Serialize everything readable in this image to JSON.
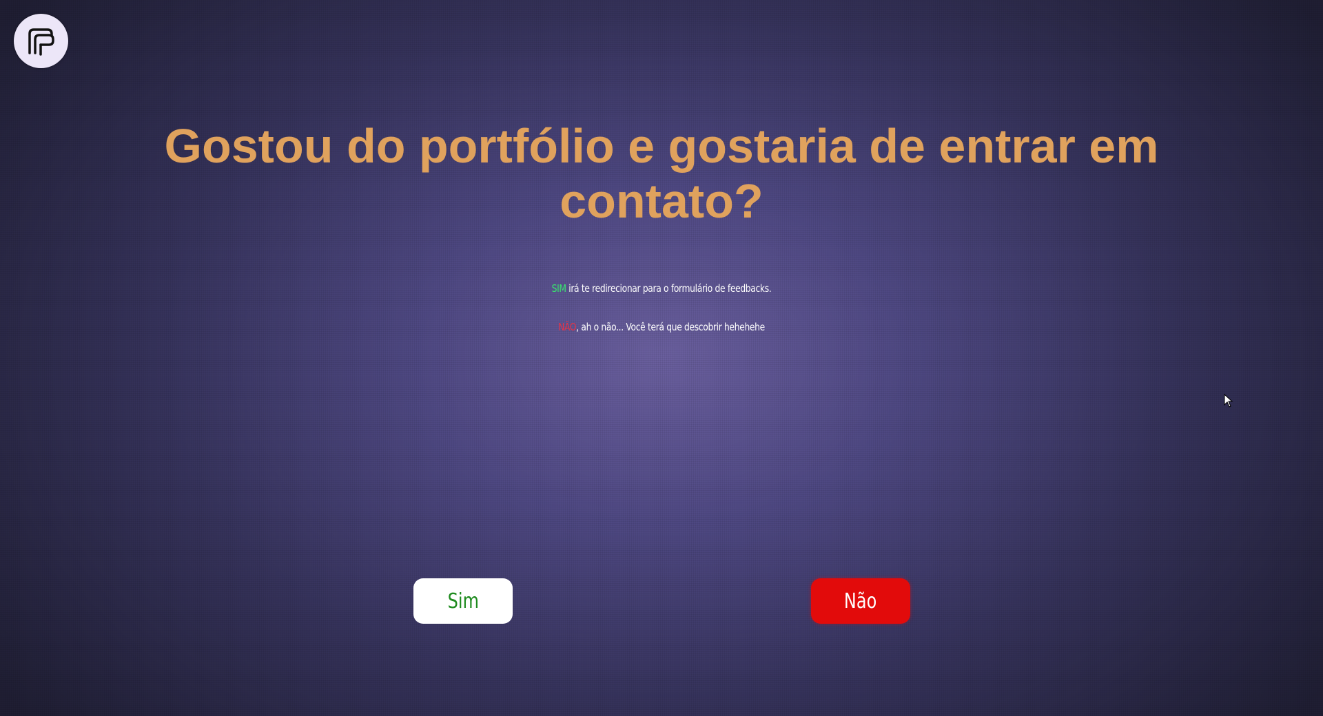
{
  "logo": {
    "icon": "brand-logo-icon",
    "background": "#ece6f8"
  },
  "heading": {
    "text": "Gostou do portfólio e gostaria de entrar em contato?"
  },
  "info": {
    "yes_keyword": "SIM",
    "yes_text": " irá te redirecionar para o formulário de feedbacks.",
    "no_keyword": "NÃO",
    "no_text": ", ah o não... Você terá que descobrir hehehehe"
  },
  "buttons": {
    "yes_label": "Sim",
    "no_label": "Não"
  },
  "colors": {
    "heading": "#e0a25d",
    "yes_keyword": "#39e86e",
    "no_keyword": "#e63346",
    "yes_button_bg": "#ffffff",
    "yes_button_text": "#1f8b1f",
    "no_button_bg": "#e20b0b",
    "no_button_text": "#ffffff"
  }
}
